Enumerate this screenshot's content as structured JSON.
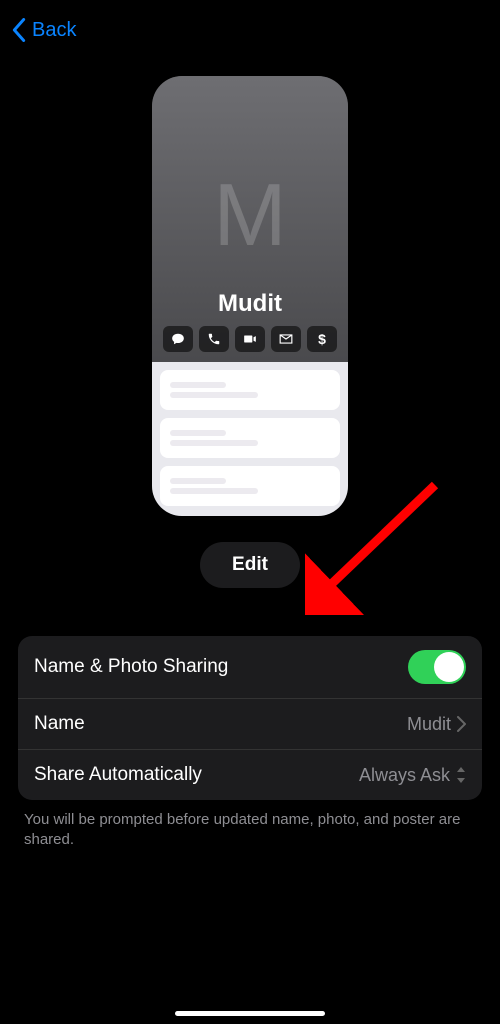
{
  "nav": {
    "back_label": "Back"
  },
  "card": {
    "monogram": "M",
    "name": "Mudit",
    "icons": [
      "message",
      "phone",
      "video",
      "mail",
      "pay"
    ]
  },
  "edit_button": "Edit",
  "settings": {
    "sharing": {
      "label": "Name & Photo Sharing",
      "on": true
    },
    "name": {
      "label": "Name",
      "value": "Mudit"
    },
    "auto": {
      "label": "Share Automatically",
      "value": "Always Ask"
    }
  },
  "footer": "You will be prompted before updated name, photo, and poster are shared.",
  "annotation_arrow": true
}
